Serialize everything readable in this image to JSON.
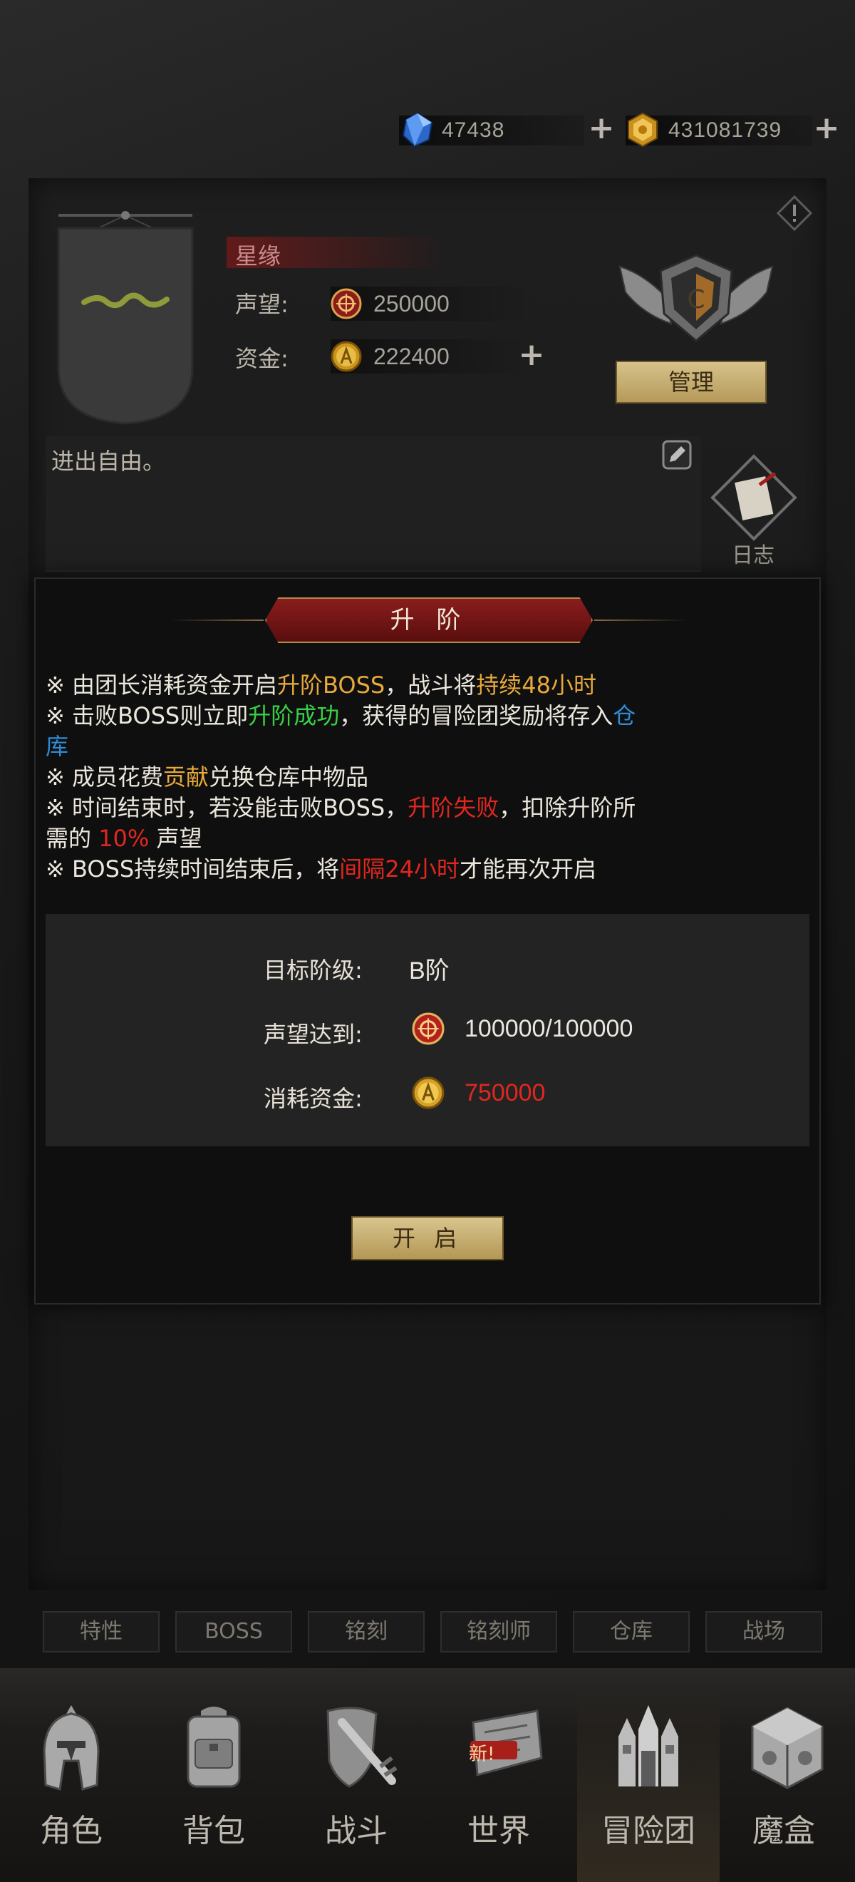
{
  "currency": {
    "diamond": "47438",
    "gold": "431081739"
  },
  "guild": {
    "name": "星缘",
    "reputation_label": "声望:",
    "reputation_value": "250000",
    "funds_label": "资金:",
    "funds_value": "222400",
    "manage_label": "管理",
    "notice": "进出自由。",
    "log_label": "日志"
  },
  "upgrade": {
    "title": "升 阶",
    "rules": [
      [
        {
          "t": "※ 由团长消耗资金开启"
        },
        {
          "t": "升阶BOSS",
          "c": "gold"
        },
        {
          "t": "，战斗将"
        },
        {
          "t": "持续48小时",
          "c": "gold"
        }
      ],
      [
        {
          "t": "※ 击败BOSS则立即"
        },
        {
          "t": "升阶成功",
          "c": "green"
        },
        {
          "t": "，获得的冒险团奖励将存入"
        },
        {
          "t": "仓",
          "c": "blue"
        }
      ],
      [
        {
          "t": "库",
          "c": "blue"
        }
      ],
      [
        {
          "t": "※ 成员花费"
        },
        {
          "t": "贡献",
          "c": "gold"
        },
        {
          "t": "兑换仓库中物品"
        }
      ],
      [
        {
          "t": "※ 时间结束时，若没能击败BOSS，"
        },
        {
          "t": "升阶失败",
          "c": "red"
        },
        {
          "t": "，扣除升阶所"
        }
      ],
      [
        {
          "t": "需的 "
        },
        {
          "t": "10%",
          "c": "red"
        },
        {
          "t": " 声望"
        }
      ],
      [
        {
          "t": "※ BOSS持续时间结束后，将"
        },
        {
          "t": "间隔24小时",
          "c": "red"
        },
        {
          "t": "才能再次开启"
        }
      ]
    ],
    "target_label": "目标阶级:",
    "target_value": "B阶",
    "rep_label": "声望达到:",
    "rep_value": "100000/100000",
    "cost_label": "消耗资金:",
    "cost_value": "750000",
    "open_label": "开 启"
  },
  "sub_tabs": [
    "特性",
    "BOSS",
    "铭刻",
    "铭刻师",
    "仓库",
    "战场"
  ],
  "nav": [
    {
      "label": "角色",
      "icon": "helmet-icon"
    },
    {
      "label": "背包",
      "icon": "backpack-icon"
    },
    {
      "label": "战斗",
      "icon": "sword-shield-icon"
    },
    {
      "label": "世界",
      "icon": "scroll-map-icon",
      "badge": "新!"
    },
    {
      "label": "冒险团",
      "icon": "castle-icon",
      "active": true
    },
    {
      "label": "魔盒",
      "icon": "magic-box-icon"
    }
  ],
  "colors": {
    "gold_text": "#e7a93b",
    "green_text": "#39d046",
    "red_text": "#e0271f",
    "blue_text": "#2f8bd6"
  }
}
